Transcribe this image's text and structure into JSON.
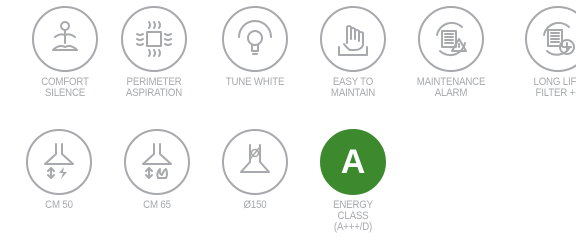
{
  "row1": [
    {
      "icon": "meditation-icon",
      "lines": [
        "COMFORT",
        "SILENCE"
      ]
    },
    {
      "icon": "perimeter-aspiration-icon",
      "lines": [
        "PERIMETER",
        "ASPIRATION"
      ]
    },
    {
      "icon": "light-bulb-icon",
      "lines": [
        "TUNE WHITE"
      ]
    },
    {
      "icon": "hand-touch-icon",
      "lines": [
        "EASY TO",
        "MAINTAIN"
      ]
    },
    {
      "icon": "filter-warning-icon",
      "lines": [
        "MAINTENANCE",
        "ALARM"
      ]
    },
    {
      "icon": "filter-plus-icon",
      "lines": [
        "LONG LIFE",
        "FILTER ++"
      ]
    }
  ],
  "row2": [
    {
      "icon": "hood-cm50-icon",
      "lines": [
        "CM 50"
      ]
    },
    {
      "icon": "hood-cm65-icon",
      "lines": [
        "CM 65"
      ]
    },
    {
      "icon": "hood-duct-icon",
      "lines": [
        "Ø150"
      ]
    },
    {
      "icon": "energy-class-badge",
      "letter": "A",
      "lines": [
        "ENERGY",
        "CLASS",
        "(A+++/D)"
      ]
    }
  ],
  "colors": {
    "icon_gray": "#a7a9ac",
    "energy_green": "#3d8a2e"
  }
}
